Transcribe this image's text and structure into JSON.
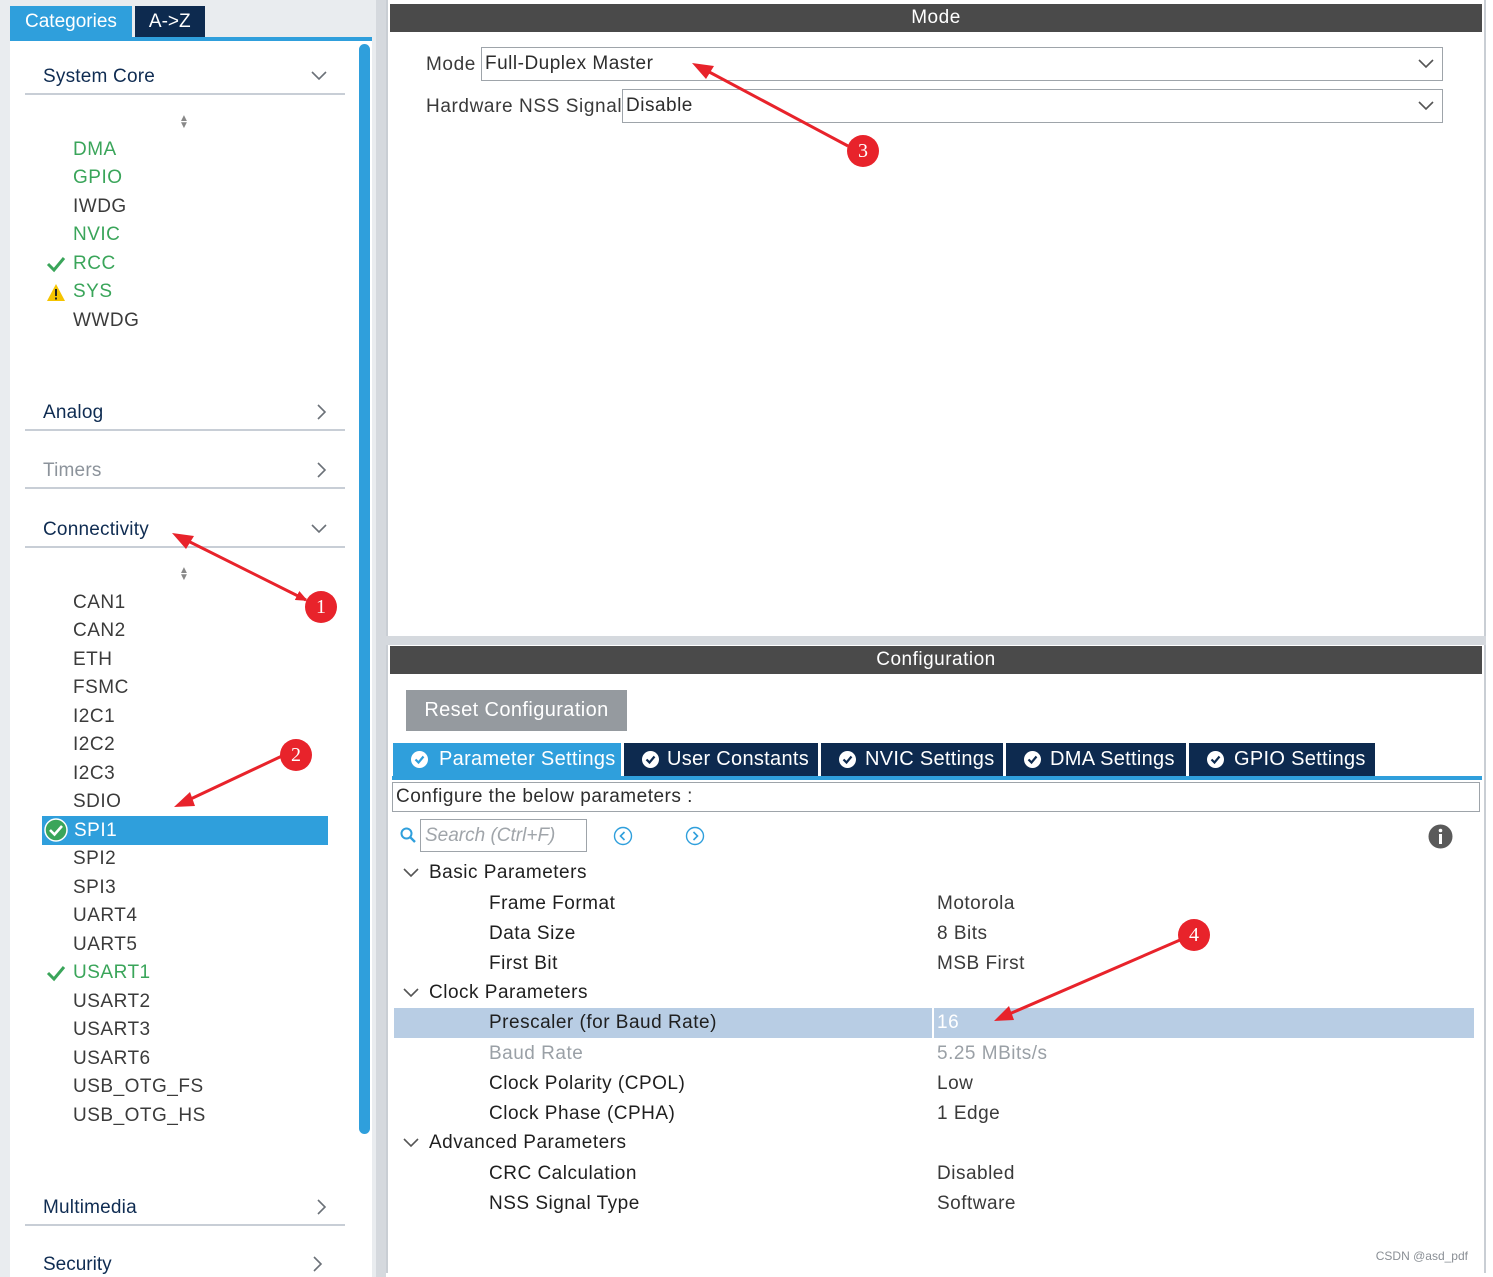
{
  "left_panel": {
    "tabs": [
      "Categories",
      "A->Z"
    ],
    "categories": {
      "system_core": "System Core",
      "analog": "Analog",
      "timers": "Timers",
      "connectivity": "Connectivity",
      "multimedia": "Multimedia",
      "security": "Security"
    },
    "system_core_items": [
      {
        "label": "DMA",
        "status": "enabled"
      },
      {
        "label": "GPIO",
        "status": "enabled"
      },
      {
        "label": "IWDG",
        "status": "none"
      },
      {
        "label": "NVIC",
        "status": "enabled"
      },
      {
        "label": "RCC",
        "status": "check"
      },
      {
        "label": "SYS",
        "status": "warning"
      },
      {
        "label": "WWDG",
        "status": "none"
      }
    ],
    "connectivity_items": [
      {
        "label": "CAN1",
        "status": "none"
      },
      {
        "label": "CAN2",
        "status": "none"
      },
      {
        "label": "ETH",
        "status": "none"
      },
      {
        "label": "FSMC",
        "status": "none"
      },
      {
        "label": "I2C1",
        "status": "none"
      },
      {
        "label": "I2C2",
        "status": "none"
      },
      {
        "label": "I2C3",
        "status": "none"
      },
      {
        "label": "SDIO",
        "status": "none"
      },
      {
        "label": "SPI1",
        "status": "selected"
      },
      {
        "label": "SPI2",
        "status": "none"
      },
      {
        "label": "SPI3",
        "status": "none"
      },
      {
        "label": "UART4",
        "status": "none"
      },
      {
        "label": "UART5",
        "status": "none"
      },
      {
        "label": "USART1",
        "status": "check"
      },
      {
        "label": "USART2",
        "status": "none"
      },
      {
        "label": "USART3",
        "status": "none"
      },
      {
        "label": "USART6",
        "status": "none"
      },
      {
        "label": "USB_OTG_FS",
        "status": "none"
      },
      {
        "label": "USB_OTG_HS",
        "status": "none"
      }
    ]
  },
  "mode_panel": {
    "title": "Mode",
    "mode_label": "Mode",
    "mode_value": "Full-Duplex Master",
    "nss_label": "Hardware NSS Signal",
    "nss_value": "Disable"
  },
  "config_panel": {
    "title": "Configuration",
    "reset_button": "Reset Configuration",
    "tabs": [
      "Parameter Settings",
      "User Constants",
      "NVIC Settings",
      "DMA Settings",
      "GPIO Settings"
    ],
    "active_tab": "Parameter Settings",
    "describe": "Configure the below parameters :",
    "search_placeholder": "Search (Ctrl+F)",
    "groups": [
      {
        "name": "Basic Parameters",
        "params": [
          {
            "name": "Frame Format",
            "value": "Motorola"
          },
          {
            "name": "Data Size",
            "value": "8 Bits"
          },
          {
            "name": "First Bit",
            "value": "MSB First"
          }
        ]
      },
      {
        "name": "Clock Parameters",
        "params": [
          {
            "name": "Prescaler (for Baud Rate)",
            "value": "16",
            "selected": true
          },
          {
            "name": "Baud Rate",
            "value": "5.25 MBits/s",
            "dim": true
          },
          {
            "name": "Clock Polarity (CPOL)",
            "value": "Low"
          },
          {
            "name": "Clock Phase (CPHA)",
            "value": "1 Edge"
          }
        ]
      },
      {
        "name": "Advanced Parameters",
        "params": [
          {
            "name": "CRC Calculation",
            "value": "Disabled"
          },
          {
            "name": "NSS Signal Type",
            "value": "Software"
          }
        ]
      }
    ]
  },
  "annotations": [
    "1",
    "2",
    "3",
    "4"
  ],
  "watermark": "CSDN @asd_pdf",
  "colors": {
    "accent_blue": "#2f9fdc",
    "navy": "#0d2a4f",
    "header_gray": "#4a4a4a",
    "enabled_green": "#3aa55a",
    "warning_yellow": "#f5c400",
    "annotation_red": "#e8232b",
    "selected_row": "#b8cde4"
  }
}
